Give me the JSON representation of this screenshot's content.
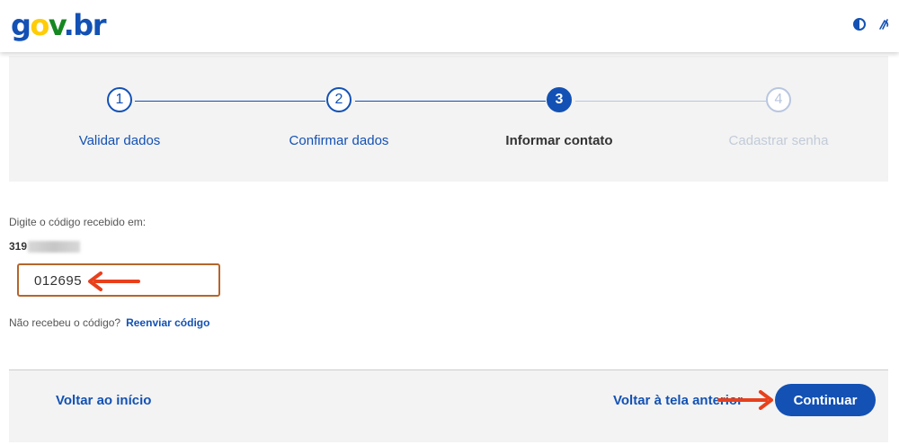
{
  "header": {
    "logo": {
      "g": "g",
      "o": "o",
      "v": "v",
      "dot": ".",
      "b": "b",
      "r": "r"
    },
    "icons": {
      "contrast": "contrast-icon",
      "accessibility": "vlibras-icon"
    }
  },
  "stepper": {
    "steps": [
      {
        "number": "1",
        "label": "Validar dados",
        "state": "done"
      },
      {
        "number": "2",
        "label": "Confirmar dados",
        "state": "done"
      },
      {
        "number": "3",
        "label": "Informar contato",
        "state": "active"
      },
      {
        "number": "4",
        "label": "Cadastrar senha",
        "state": "disabled"
      }
    ]
  },
  "form": {
    "prompt": "Digite o código recebido em:",
    "phone_prefix": "319",
    "code_value": "012695",
    "resend_question": "Não recebeu o código?",
    "resend_link": "Reenviar código"
  },
  "footer": {
    "back_start": "Voltar ao início",
    "back_previous": "Voltar à tela anterior",
    "continue": "Continuar"
  },
  "colors": {
    "primary": "#1351b4",
    "annotation_arrow": "#e8401c",
    "highlight_box": "#b5652a"
  }
}
